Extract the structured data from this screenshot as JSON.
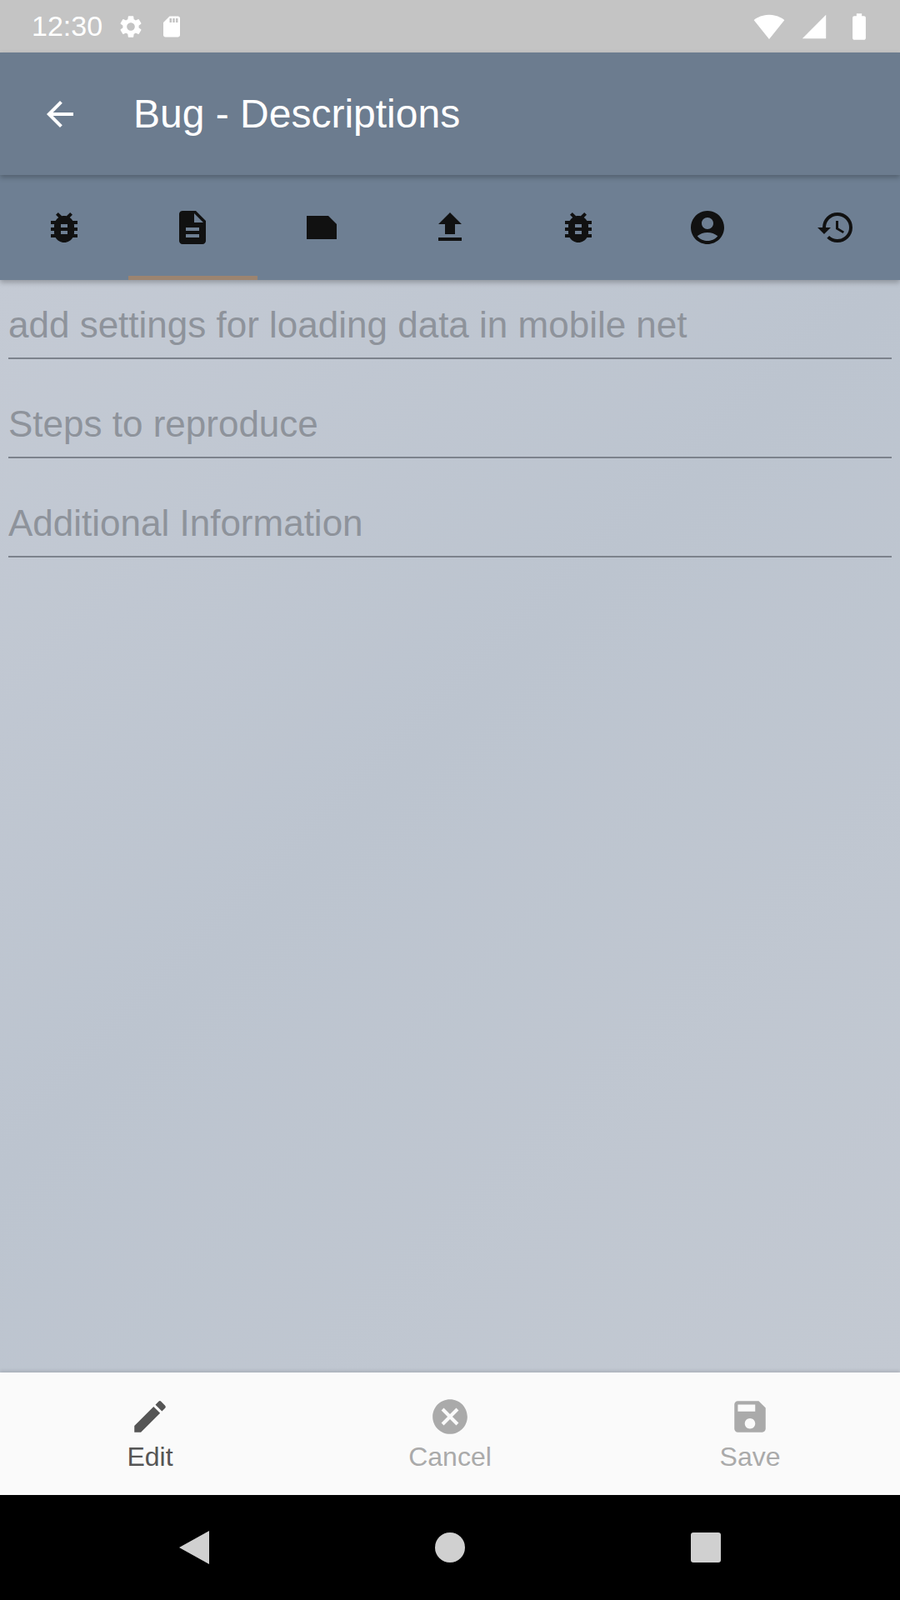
{
  "status_bar": {
    "time": "12:30"
  },
  "window": {
    "title": "Bug - Descriptions"
  },
  "tabs": [
    {
      "selected": false
    },
    {
      "selected": true
    },
    {
      "selected": false
    },
    {
      "selected": false
    },
    {
      "selected": false
    },
    {
      "selected": false
    },
    {
      "selected": false
    }
  ],
  "fields": [
    {
      "text": "add settings for loading data in mobile net",
      "disabled": true
    },
    {
      "text": "Steps to reproduce",
      "disabled": true
    },
    {
      "text": "Additional Information",
      "disabled": true
    }
  ],
  "actions": [
    {
      "label": "Edit",
      "disabled": false
    },
    {
      "label": "Cancel",
      "disabled": true
    },
    {
      "label": "Save",
      "disabled": true
    }
  ]
}
